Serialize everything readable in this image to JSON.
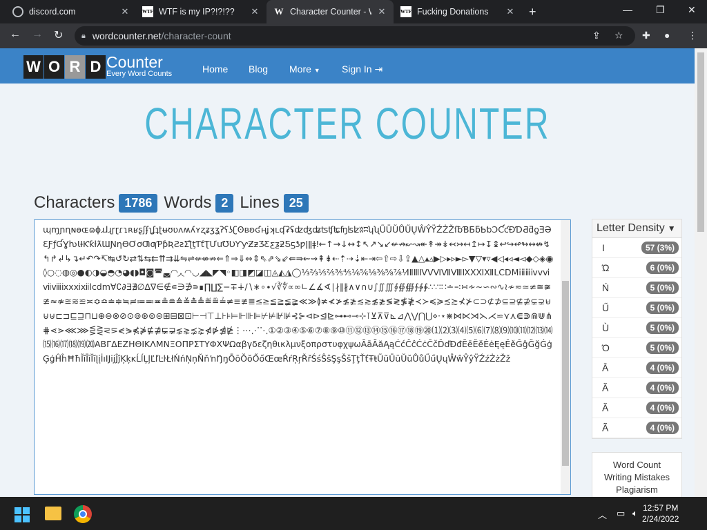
{
  "tabs": [
    {
      "title": "discord.com",
      "favicon": "globe-icon"
    },
    {
      "title": "WTF is my IP?!?!??",
      "favicon": "WTF"
    },
    {
      "title": "Character Counter - W",
      "favicon": "W",
      "active": true
    },
    {
      "title": "Fucking Donations",
      "favicon": "WTF"
    }
  ],
  "address": {
    "domain": "wordcounter.net",
    "path": "/character-count"
  },
  "site": {
    "logo_letters": [
      "W",
      "O",
      "R",
      "D"
    ],
    "logo_big": "Counter",
    "logo_small": "Every Word Counts",
    "menu": {
      "home": "Home",
      "blog": "Blog",
      "more": "More",
      "signin": "Sign In"
    },
    "heading": "CHARACTER COUNTER"
  },
  "stats": {
    "characters_label": "Characters",
    "characters": "1786",
    "words_label": "Words",
    "words": "2",
    "lines_label": "Lines",
    "lines": "25"
  },
  "textarea": {
    "content": "ɰɱɲɳɴɵɶɷɸɹɺɻɼɽɾɿʀʁʂʃʄʅʆʇʈʉʊʋʌʍʎʏʐʑʒʓʔʕʖʗʘʙʚʛʜʝʞʟʠʡʢʣʤʥʦʧʨʩʪʫʬʭʮʯŨŪŬŮŰŲŴŶŸŹŻŽſƀƁƂƃƄƅƆƇƈƉƊƋƌƍƎƏƐƑƒƓƔƕƖƗƘƙƚƛƜƝƞƟƠơƢƣƤƥƦƧƨƩƪƫƬƭƮƯưƱƲƳƴƵƶƷƸƹƺƻƼƽƾƿǀǁǂǃ←↑→↓↔↕↖↗↘↙↚↛↜↝↞↟↠↡↢↣↤↥↦↧↨↩↪↫↬↭↮↯↰↱↲↳↴↵↶↷↸↹↺↻⇄⇅⇆⇇⇈⇉⇊⇋⇌⇍⇎⇏⇐⇑⇒⇓⇔⇕⇖⇗⇘⇙⇚⇛⇜⇝⇞⇟⇠⇡⇢⇣⇤⇥⇦⇧⇨⇩⇪▲△▴▵▶▷▸▹►▻▼▽▾▿◀◁◂◃◄◅◆◇◈◉◊○◌◍◎●◐◑◒◓◔◕◖◗◘◙◚◛◜◝◞◟◠◡◢◣◤◥◦◧◨◩◪◫◬◭◮◯⅓⅔⅕⅖⅗⅘⅙⅚⅛⅜⅝⅞⅟ⅠⅡⅢⅣⅤⅥⅦⅧⅨⅩⅪⅫⅬⅭⅮⅯⅰⅱⅲⅳⅴⅵⅶⅷⅸⅹⅺⅻⅼⅽⅾⅿ∀∁∂∃∄∅∆∇∈∉∊∋∌∍∎∏∐∑−∓∔∕∖∗∘∙√∛∜∝∞∟∠∡∢∣∤∥∦∧∨∩∪∫∬∭∮∯∰∱∲∳∴∵∶∷∸∹∺∻∼∽∾∿≀≁≂≃≄≅≆≇≈≉≊≋≌≍≎≏≐≑≒≓≔≕≖≗≘≙≚≛≜≝≞≟≠≡≢≣≤≥≦≧≨≩≪≫≬≭≮≯≰≱≲≳≴≵≶≷≸≹≺≻≼≽≾≿⊀⊁⊂⊃⊄⊅⊆⊇⊈⊉⊊⊋⊌⊍⊎⊏⊐⊑⊒⊓⊔⊕⊖⊗⊘⊙⊚⊛⊜⊝⊞⊟⊠⊡⊢⊣⊤⊥⊦⊧⊨⊩⊪⊫⊬⊭⊮⊯⊰⊱⊲⊳⊴⊵⊶⊷⊸⊹⊺⊻⊼⊽⊾⊿⋀⋁⋂⋃⋄⋅⋆⋇⋈⋉⋊⋋⋌⋍⋎⋏⋐⋑⋒⋓⋔⋕⋖⋗⋘⋙⋚⋛⋜⋝⋞⋟⋠⋡⋢⋣⋤⋥⋦⋧⋨⋩⋪⋫⋬⋭⋮⋯⋰⋱①②③④⑤⑥⑦⑧⑨⑩⑪⑫⑬⑭⑮⑯⑰⑱⑲⑳⑴⑵⑶⑷⑸⑹⑺⑻⑼⑽⑾⑿⒀⒁⒂⒃⒄⒅⒆⒇ΑΒΓΔΕΖΗΘΙΚΛΜΝΞΟΠΡΣΤΥΦΧΨΩαβγδεζηθικλμνξοπρστυφχψωĀāĂăĄąĆćĈĉĊċČčĎďĐđĒēĔĕĖėĘęĚěĜĝĞğĠġĢģĤĥĦħĨĩĪīĬĭĮįİıĲĳĴĵĶķĸĹĺĻļĽľĿŀŁłŃńŅņŇňŉŊŋŌōŎŏŐőŒœŔŕŖŗŘřŚśŜŝŞşŠšŢţŤťŦŧŨũŪūŬŭŮůŰűŲųŴŵŶŷŸŹźŻżŽž"
  },
  "density": {
    "title": "Letter Density",
    "items": [
      {
        "char": "I",
        "count": "57 (3%)"
      },
      {
        "char": "Ώ",
        "count": "6 (0%)"
      },
      {
        "char": "Ń",
        "count": "5 (0%)"
      },
      {
        "char": "Ű",
        "count": "5 (0%)"
      },
      {
        "char": "Ù",
        "count": "5 (0%)"
      },
      {
        "char": "Ό",
        "count": "5 (0%)"
      },
      {
        "char": "Ā",
        "count": "4 (0%)"
      },
      {
        "char": "Ă",
        "count": "4 (0%)"
      },
      {
        "char": "Ă",
        "count": "4 (0%)"
      },
      {
        "char": "Ã",
        "count": "4 (0%)"
      }
    ]
  },
  "sidelinks": [
    "Word Count",
    "Writing Mistakes",
    "Plagiarism"
  ],
  "clock": {
    "time": "12:57 PM",
    "date": "2/24/2022"
  }
}
